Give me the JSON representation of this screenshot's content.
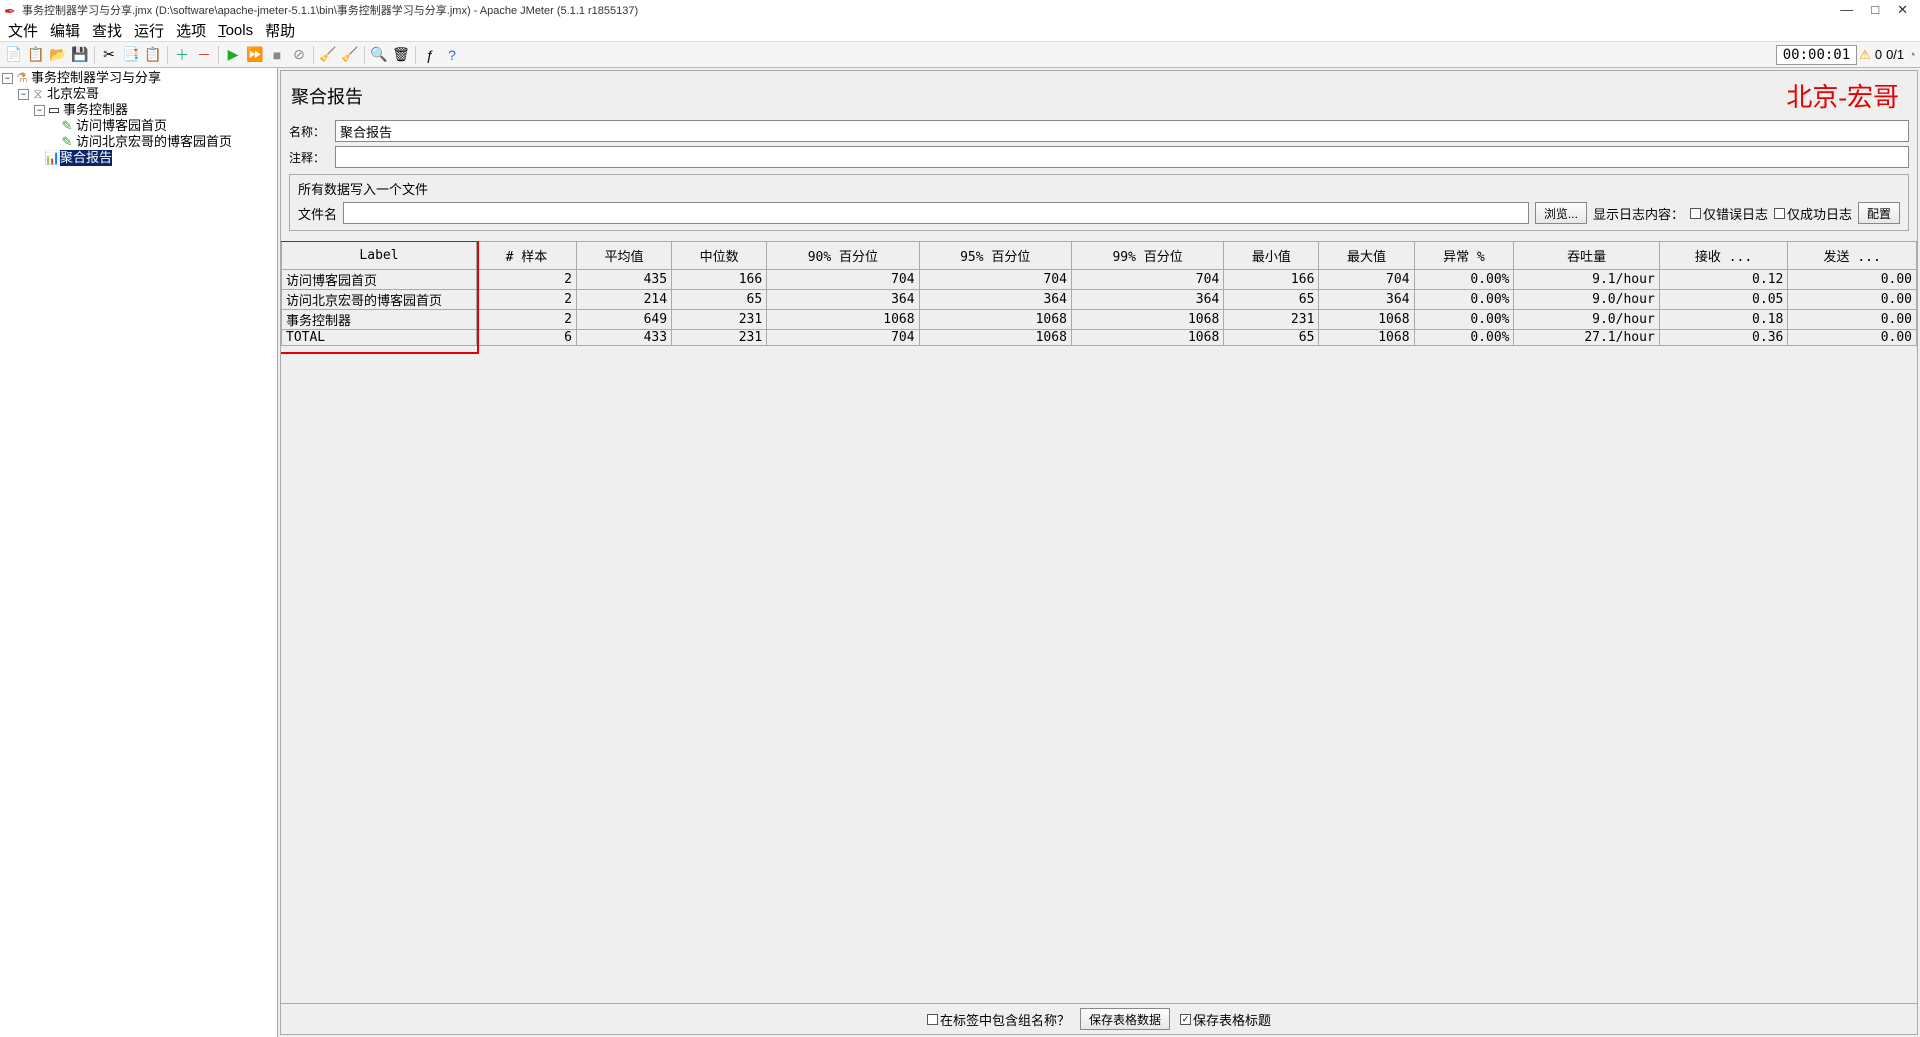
{
  "window": {
    "title": "事务控制器学习与分享.jmx (D:\\software\\apache-jmeter-5.1.1\\bin\\事务控制器学习与分享.jmx) - Apache JMeter (5.1.1 r1855137)",
    "timer": "00:00:01",
    "warn_count": "0",
    "thread_count": "0/1"
  },
  "menu": {
    "file": "文件",
    "edit": "编辑",
    "search": "查找",
    "run": "运行",
    "options": "选项",
    "tools": "Tools",
    "help": "帮助"
  },
  "tree": {
    "root": "事务控制器学习与分享",
    "tg": "北京宏哥",
    "tc": "事务控制器",
    "req1": "访问博客园首页",
    "req2": "访问北京宏哥的博客园首页",
    "report": "聚合报告"
  },
  "panel": {
    "title": "聚合报告",
    "watermark": "北京-宏哥",
    "name_label": "名称：",
    "name_value": "聚合报告",
    "comment_label": "注释：",
    "comment_value": "",
    "file_section_title": "所有数据写入一个文件",
    "filename_label": "文件名",
    "filename_value": "",
    "browse": "浏览...",
    "log_display_label": "显示日志内容：",
    "only_error": "仅错误日志",
    "only_success": "仅成功日志",
    "configure": "配置"
  },
  "table": {
    "headers": [
      "Label",
      "# 样本",
      "平均值",
      "中位数",
      "90% 百分位",
      "95% 百分位",
      "99% 百分位",
      "最小值",
      "最大值",
      "异常 %",
      "吞吐量",
      "接收 ...",
      "发送 ..."
    ],
    "rows": [
      {
        "label": "访问博客园首页",
        "samples": "2",
        "avg": "435",
        "median": "166",
        "p90": "704",
        "p95": "704",
        "p99": "704",
        "min": "166",
        "max": "704",
        "err": "0.00%",
        "thr": "9.1/hour",
        "recv": "0.12",
        "sent": "0.00"
      },
      {
        "label": "访问北京宏哥的博客园首页",
        "samples": "2",
        "avg": "214",
        "median": "65",
        "p90": "364",
        "p95": "364",
        "p99": "364",
        "min": "65",
        "max": "364",
        "err": "0.00%",
        "thr": "9.0/hour",
        "recv": "0.05",
        "sent": "0.00"
      },
      {
        "label": "事务控制器",
        "samples": "2",
        "avg": "649",
        "median": "231",
        "p90": "1068",
        "p95": "1068",
        "p99": "1068",
        "min": "231",
        "max": "1068",
        "err": "0.00%",
        "thr": "9.0/hour",
        "recv": "0.18",
        "sent": "0.00"
      },
      {
        "label": "TOTAL",
        "samples": "6",
        "avg": "433",
        "median": "231",
        "p90": "704",
        "p95": "1068",
        "p99": "1068",
        "min": "65",
        "max": "1068",
        "err": "0.00%",
        "thr": "27.1/hour",
        "recv": "0.36",
        "sent": "0.00"
      }
    ]
  },
  "footer": {
    "include_group": "在标签中包含组名称？",
    "save_table_data": "保存表格数据",
    "save_table_header": "保存表格标题"
  }
}
